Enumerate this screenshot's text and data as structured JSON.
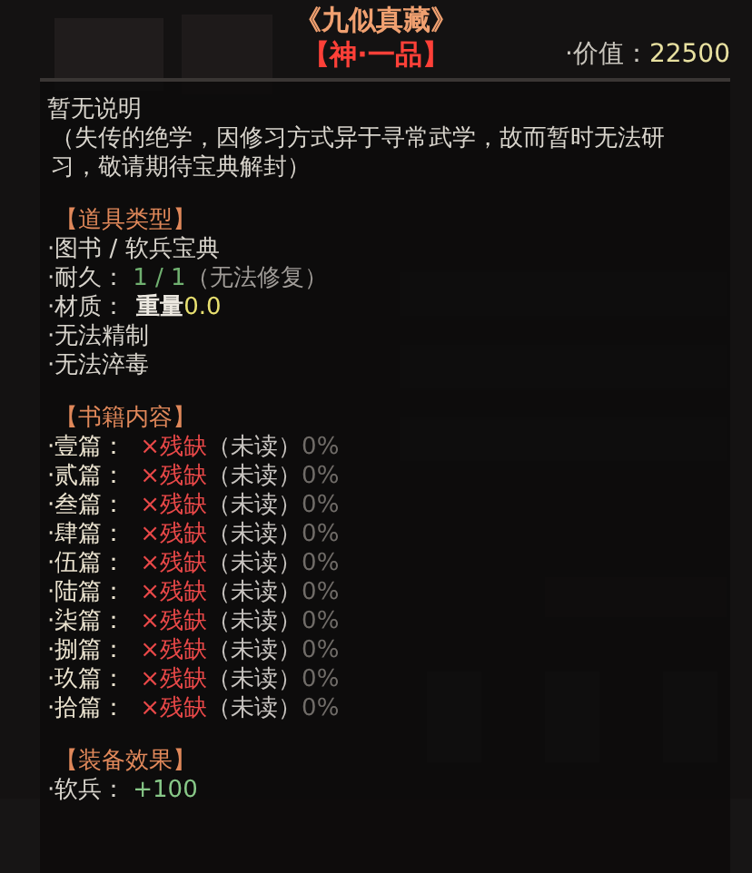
{
  "header": {
    "title": "《九似真藏》",
    "grade": "【神·一品】",
    "value_label": "·价值：",
    "value": "22500"
  },
  "description": {
    "title": "暂无说明",
    "text": "（失传的绝学，因修习方式异于寻常武学，故而暂时无法研习，敬请期待宝典解封）"
  },
  "item_type": {
    "heading": "【道具类型】",
    "lines": [
      {
        "kind": "plain",
        "text": "·图书 / 软兵宝典"
      },
      {
        "kind": "durability",
        "label": "·耐久：",
        "value": "1 / 1",
        "note": "（无法修复）"
      },
      {
        "kind": "material",
        "label": "·材质：",
        "name": "重量",
        "value": "0.0"
      },
      {
        "kind": "plain",
        "text": "·无法精制"
      },
      {
        "kind": "plain",
        "text": "·无法淬毒"
      }
    ]
  },
  "book_contents": {
    "heading": "【书籍内容】",
    "chapters": [
      {
        "name": "·壹篇：",
        "status": "×残缺",
        "read": "（未读）",
        "progress": "0%"
      },
      {
        "name": "·贰篇：",
        "status": "×残缺",
        "read": "（未读）",
        "progress": "0%"
      },
      {
        "name": "·叁篇：",
        "status": "×残缺",
        "read": "（未读）",
        "progress": "0%"
      },
      {
        "name": "·肆篇：",
        "status": "×残缺",
        "read": "（未读）",
        "progress": "0%"
      },
      {
        "name": "·伍篇：",
        "status": "×残缺",
        "read": "（未读）",
        "progress": "0%"
      },
      {
        "name": "·陆篇：",
        "status": "×残缺",
        "read": "（未读）",
        "progress": "0%"
      },
      {
        "name": "·柒篇：",
        "status": "×残缺",
        "read": "（未读）",
        "progress": "0%"
      },
      {
        "name": "·捌篇：",
        "status": "×残缺",
        "read": "（未读）",
        "progress": "0%"
      },
      {
        "name": "·玖篇：",
        "status": "×残缺",
        "read": "（未读）",
        "progress": "0%"
      },
      {
        "name": "·拾篇：",
        "status": "×残缺",
        "read": "（未读）",
        "progress": "0%"
      }
    ]
  },
  "equip_effects": {
    "heading": "【装备效果】",
    "effects": [
      {
        "label": "·软兵：",
        "value": "+100"
      }
    ]
  }
}
